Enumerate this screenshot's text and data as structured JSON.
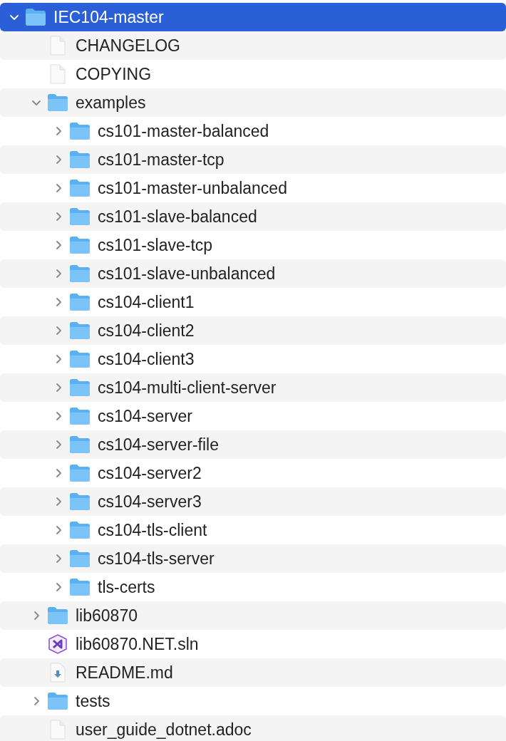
{
  "tree": [
    {
      "name": "IEC104-master",
      "kind": "folder",
      "expanded": true,
      "selected": true,
      "children": [
        {
          "name": "CHANGELOG",
          "kind": "file",
          "selected": false
        },
        {
          "name": "COPYING",
          "kind": "file",
          "selected": false
        },
        {
          "name": "examples",
          "kind": "folder",
          "expanded": true,
          "selected": false,
          "children": [
            {
              "name": "cs101-master-balanced",
              "kind": "folder",
              "expanded": false,
              "selected": false
            },
            {
              "name": "cs101-master-tcp",
              "kind": "folder",
              "expanded": false,
              "selected": false
            },
            {
              "name": "cs101-master-unbalanced",
              "kind": "folder",
              "expanded": false,
              "selected": false
            },
            {
              "name": "cs101-slave-balanced",
              "kind": "folder",
              "expanded": false,
              "selected": false
            },
            {
              "name": "cs101-slave-tcp",
              "kind": "folder",
              "expanded": false,
              "selected": false
            },
            {
              "name": "cs101-slave-unbalanced",
              "kind": "folder",
              "expanded": false,
              "selected": false
            },
            {
              "name": "cs104-client1",
              "kind": "folder",
              "expanded": false,
              "selected": false
            },
            {
              "name": "cs104-client2",
              "kind": "folder",
              "expanded": false,
              "selected": false
            },
            {
              "name": "cs104-client3",
              "kind": "folder",
              "expanded": false,
              "selected": false
            },
            {
              "name": "cs104-multi-client-server",
              "kind": "folder",
              "expanded": false,
              "selected": false
            },
            {
              "name": "cs104-server",
              "kind": "folder",
              "expanded": false,
              "selected": false
            },
            {
              "name": "cs104-server-file",
              "kind": "folder",
              "expanded": false,
              "selected": false
            },
            {
              "name": "cs104-server2",
              "kind": "folder",
              "expanded": false,
              "selected": false
            },
            {
              "name": "cs104-server3",
              "kind": "folder",
              "expanded": false,
              "selected": false
            },
            {
              "name": "cs104-tls-client",
              "kind": "folder",
              "expanded": false,
              "selected": false
            },
            {
              "name": "cs104-tls-server",
              "kind": "folder",
              "expanded": false,
              "selected": false
            },
            {
              "name": "tls-certs",
              "kind": "folder",
              "expanded": false,
              "selected": false
            }
          ]
        },
        {
          "name": "lib60870",
          "kind": "folder",
          "expanded": false,
          "selected": false
        },
        {
          "name": "lib60870.NET.sln",
          "kind": "solution",
          "selected": false
        },
        {
          "name": "README.md",
          "kind": "markdown",
          "selected": false
        },
        {
          "name": "tests",
          "kind": "folder",
          "expanded": false,
          "selected": false
        },
        {
          "name": "user_guide_dotnet.adoc",
          "kind": "file",
          "selected": false
        }
      ]
    }
  ]
}
